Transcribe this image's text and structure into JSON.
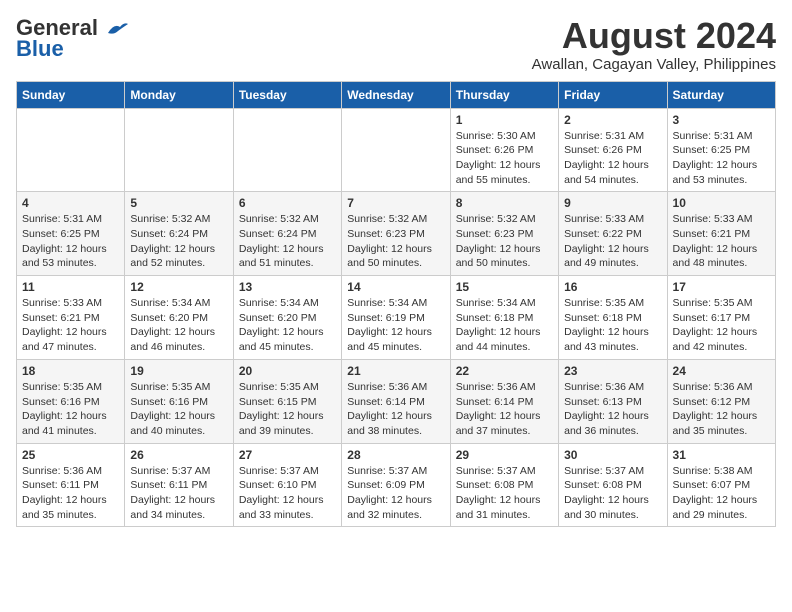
{
  "header": {
    "logo_line1": "General",
    "logo_line2": "Blue",
    "month_title": "August 2024",
    "location": "Awallan, Cagayan Valley, Philippines"
  },
  "weekdays": [
    "Sunday",
    "Monday",
    "Tuesday",
    "Wednesday",
    "Thursday",
    "Friday",
    "Saturday"
  ],
  "weeks": [
    [
      {
        "day": "",
        "info": ""
      },
      {
        "day": "",
        "info": ""
      },
      {
        "day": "",
        "info": ""
      },
      {
        "day": "",
        "info": ""
      },
      {
        "day": "1",
        "info": "Sunrise: 5:30 AM\nSunset: 6:26 PM\nDaylight: 12 hours\nand 55 minutes."
      },
      {
        "day": "2",
        "info": "Sunrise: 5:31 AM\nSunset: 6:26 PM\nDaylight: 12 hours\nand 54 minutes."
      },
      {
        "day": "3",
        "info": "Sunrise: 5:31 AM\nSunset: 6:25 PM\nDaylight: 12 hours\nand 53 minutes."
      }
    ],
    [
      {
        "day": "4",
        "info": "Sunrise: 5:31 AM\nSunset: 6:25 PM\nDaylight: 12 hours\nand 53 minutes."
      },
      {
        "day": "5",
        "info": "Sunrise: 5:32 AM\nSunset: 6:24 PM\nDaylight: 12 hours\nand 52 minutes."
      },
      {
        "day": "6",
        "info": "Sunrise: 5:32 AM\nSunset: 6:24 PM\nDaylight: 12 hours\nand 51 minutes."
      },
      {
        "day": "7",
        "info": "Sunrise: 5:32 AM\nSunset: 6:23 PM\nDaylight: 12 hours\nand 50 minutes."
      },
      {
        "day": "8",
        "info": "Sunrise: 5:32 AM\nSunset: 6:23 PM\nDaylight: 12 hours\nand 50 minutes."
      },
      {
        "day": "9",
        "info": "Sunrise: 5:33 AM\nSunset: 6:22 PM\nDaylight: 12 hours\nand 49 minutes."
      },
      {
        "day": "10",
        "info": "Sunrise: 5:33 AM\nSunset: 6:21 PM\nDaylight: 12 hours\nand 48 minutes."
      }
    ],
    [
      {
        "day": "11",
        "info": "Sunrise: 5:33 AM\nSunset: 6:21 PM\nDaylight: 12 hours\nand 47 minutes."
      },
      {
        "day": "12",
        "info": "Sunrise: 5:34 AM\nSunset: 6:20 PM\nDaylight: 12 hours\nand 46 minutes."
      },
      {
        "day": "13",
        "info": "Sunrise: 5:34 AM\nSunset: 6:20 PM\nDaylight: 12 hours\nand 45 minutes."
      },
      {
        "day": "14",
        "info": "Sunrise: 5:34 AM\nSunset: 6:19 PM\nDaylight: 12 hours\nand 45 minutes."
      },
      {
        "day": "15",
        "info": "Sunrise: 5:34 AM\nSunset: 6:18 PM\nDaylight: 12 hours\nand 44 minutes."
      },
      {
        "day": "16",
        "info": "Sunrise: 5:35 AM\nSunset: 6:18 PM\nDaylight: 12 hours\nand 43 minutes."
      },
      {
        "day": "17",
        "info": "Sunrise: 5:35 AM\nSunset: 6:17 PM\nDaylight: 12 hours\nand 42 minutes."
      }
    ],
    [
      {
        "day": "18",
        "info": "Sunrise: 5:35 AM\nSunset: 6:16 PM\nDaylight: 12 hours\nand 41 minutes."
      },
      {
        "day": "19",
        "info": "Sunrise: 5:35 AM\nSunset: 6:16 PM\nDaylight: 12 hours\nand 40 minutes."
      },
      {
        "day": "20",
        "info": "Sunrise: 5:35 AM\nSunset: 6:15 PM\nDaylight: 12 hours\nand 39 minutes."
      },
      {
        "day": "21",
        "info": "Sunrise: 5:36 AM\nSunset: 6:14 PM\nDaylight: 12 hours\nand 38 minutes."
      },
      {
        "day": "22",
        "info": "Sunrise: 5:36 AM\nSunset: 6:14 PM\nDaylight: 12 hours\nand 37 minutes."
      },
      {
        "day": "23",
        "info": "Sunrise: 5:36 AM\nSunset: 6:13 PM\nDaylight: 12 hours\nand 36 minutes."
      },
      {
        "day": "24",
        "info": "Sunrise: 5:36 AM\nSunset: 6:12 PM\nDaylight: 12 hours\nand 35 minutes."
      }
    ],
    [
      {
        "day": "25",
        "info": "Sunrise: 5:36 AM\nSunset: 6:11 PM\nDaylight: 12 hours\nand 35 minutes."
      },
      {
        "day": "26",
        "info": "Sunrise: 5:37 AM\nSunset: 6:11 PM\nDaylight: 12 hours\nand 34 minutes."
      },
      {
        "day": "27",
        "info": "Sunrise: 5:37 AM\nSunset: 6:10 PM\nDaylight: 12 hours\nand 33 minutes."
      },
      {
        "day": "28",
        "info": "Sunrise: 5:37 AM\nSunset: 6:09 PM\nDaylight: 12 hours\nand 32 minutes."
      },
      {
        "day": "29",
        "info": "Sunrise: 5:37 AM\nSunset: 6:08 PM\nDaylight: 12 hours\nand 31 minutes."
      },
      {
        "day": "30",
        "info": "Sunrise: 5:37 AM\nSunset: 6:08 PM\nDaylight: 12 hours\nand 30 minutes."
      },
      {
        "day": "31",
        "info": "Sunrise: 5:38 AM\nSunset: 6:07 PM\nDaylight: 12 hours\nand 29 minutes."
      }
    ]
  ]
}
